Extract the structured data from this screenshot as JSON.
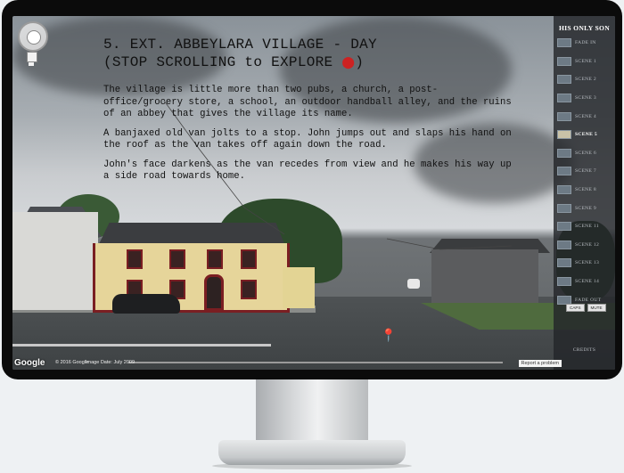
{
  "scene": {
    "title": "5. EXT. ABBEYLARA VILLAGE - DAY",
    "subtitle": "(STOP SCROLLING to EXPLORE",
    "subtitle_end": ")",
    "paragraphs": [
      "The village is little more than two pubs, a church, a post- office/grocery store, a school, an outdoor handball alley, and the ruins of an abbey that gives the village its name.",
      "A banjaxed old van jolts to a stop. John jumps out and slaps his hand on the roof as the van takes off again down the road.",
      "John's face darkens as the van recedes from view and he makes his way up a side road towards home."
    ]
  },
  "sidebar": {
    "brand": "HIS ONLY SON",
    "items": [
      {
        "label": "FADE IN",
        "active": false
      },
      {
        "label": "SCENE 1",
        "active": false
      },
      {
        "label": "SCENE 2",
        "active": false
      },
      {
        "label": "SCENE 3",
        "active": false
      },
      {
        "label": "SCENE 4",
        "active": false
      },
      {
        "label": "SCENE 5",
        "active": true
      },
      {
        "label": "SCENE 6",
        "active": false
      },
      {
        "label": "SCENE 7",
        "active": false
      },
      {
        "label": "SCENE 8",
        "active": false
      },
      {
        "label": "SCENE 9",
        "active": false
      },
      {
        "label": "SCENE 11",
        "active": false
      },
      {
        "label": "SCENE 12",
        "active": false
      },
      {
        "label": "SCENE 13",
        "active": false
      },
      {
        "label": "SCENE 14",
        "active": false
      },
      {
        "label": "FADE OUT",
        "active": false
      }
    ],
    "credits": "CREDITS",
    "caps_label": "CAPS",
    "mute_label": "MUTE"
  },
  "map": {
    "google": "Google",
    "copyright": "© 2016 Google",
    "image_date": "Image Date: July 2009",
    "report": "Report a problem"
  },
  "colors": {
    "accent_red": "#cc2222",
    "pub_trim": "#7a1e22",
    "sidebar_bg": "#23262a"
  }
}
